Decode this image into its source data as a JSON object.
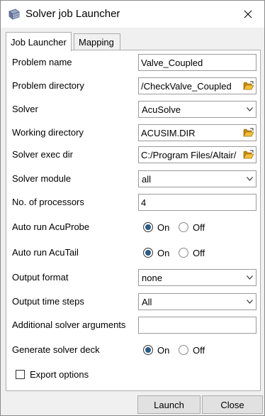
{
  "window": {
    "title": "Solver job Launcher"
  },
  "tabs": [
    {
      "label": "Job Launcher",
      "active": true
    },
    {
      "label": "Mapping",
      "active": false
    }
  ],
  "fields": {
    "problem_name": {
      "label": "Problem name",
      "value": "Valve_Coupled"
    },
    "problem_directory": {
      "label": "Problem directory",
      "value": "/CheckValve_Coupled"
    },
    "solver": {
      "label": "Solver",
      "value": "AcuSolve"
    },
    "working_directory": {
      "label": "Working directory",
      "value": "ACUSIM.DIR"
    },
    "solver_exec_dir": {
      "label": "Solver exec dir",
      "value": "C:/Program Files/Altair/"
    },
    "solver_module": {
      "label": "Solver module",
      "value": "all"
    },
    "num_processors": {
      "label": "No. of processors",
      "value": "4"
    },
    "auto_run_acuprobe": {
      "label": "Auto run AcuProbe",
      "on_label": "On",
      "off_label": "Off",
      "selected": "On"
    },
    "auto_run_acutail": {
      "label": "Auto run AcuTail",
      "on_label": "On",
      "off_label": "Off",
      "selected": "On"
    },
    "output_format": {
      "label": "Output format",
      "value": "none"
    },
    "output_time_steps": {
      "label": "Output time steps",
      "value": "All"
    },
    "additional_args": {
      "label": "Additional solver arguments",
      "value": ""
    },
    "generate_solver_deck": {
      "label": "Generate solver deck",
      "on_label": "On",
      "off_label": "Off",
      "selected": "On"
    }
  },
  "export_options": {
    "label": "Export options",
    "checked": false
  },
  "buttons": {
    "launch": "Launch",
    "close": "Close"
  },
  "icons": {
    "app": "grid-app-icon",
    "close": "close-icon",
    "folder": "folder-open-icon",
    "dropdown": "chevron-down-icon"
  },
  "colors": {
    "radio_selected": "#2a5b86",
    "folder": "#e3a21a"
  }
}
